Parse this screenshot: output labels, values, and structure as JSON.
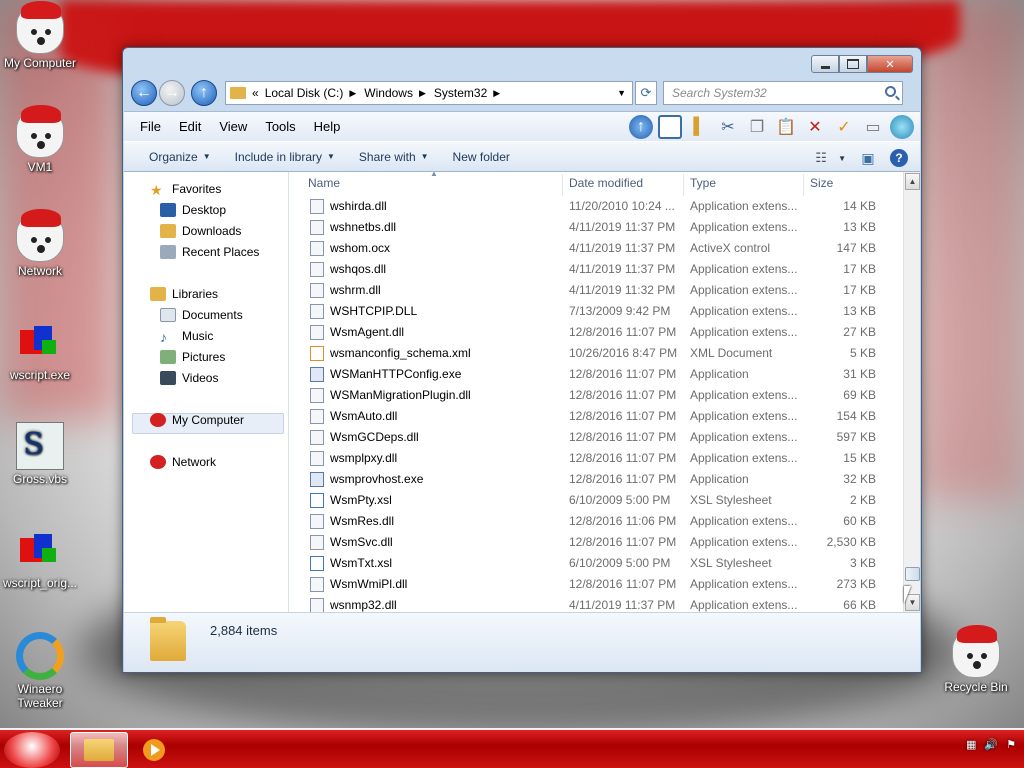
{
  "desktop": {
    "icons": [
      {
        "label": "My Computer",
        "kind": "dog-icon"
      },
      {
        "label": "VM1",
        "kind": "dog-icon"
      },
      {
        "label": "Network",
        "kind": "dog-icon"
      },
      {
        "label": "wscript.exe",
        "kind": "cube-icon"
      },
      {
        "label": "Gross.vbs",
        "kind": "script-icon"
      },
      {
        "label": "wscript_orig...",
        "kind": "cube-icon"
      },
      {
        "label": "Winaero Tweaker",
        "kind": "winaero-icon"
      },
      {
        "label": "Recycle Bin",
        "kind": "dog-icon"
      }
    ]
  },
  "window": {
    "address": {
      "prefix": "«",
      "segments": [
        "Local Disk (C:)",
        "Windows",
        "System32"
      ]
    },
    "search": {
      "placeholder": "Search System32"
    },
    "menu": [
      "File",
      "Edit",
      "View",
      "Tools",
      "Help"
    ],
    "commands": {
      "organize": "Organize",
      "include": "Include in library",
      "share": "Share with",
      "new_folder": "New folder"
    },
    "nav": {
      "favorites": "Favorites",
      "desktop": "Desktop",
      "downloads": "Downloads",
      "recent": "Recent Places",
      "libraries": "Libraries",
      "documents": "Documents",
      "music": "Music",
      "pictures": "Pictures",
      "videos": "Videos",
      "computer": "My Computer",
      "network": "Network"
    },
    "columns": {
      "name": "Name",
      "date": "Date modified",
      "type": "Type",
      "size": "Size"
    },
    "files": [
      {
        "name": "wshirda.dll",
        "date": "11/20/2010 10:24 ...",
        "type": "Application extens...",
        "size": "14 KB"
      },
      {
        "name": "wshnetbs.dll",
        "date": "4/11/2019 11:37 PM",
        "type": "Application extens...",
        "size": "13 KB"
      },
      {
        "name": "wshom.ocx",
        "date": "4/11/2019 11:37 PM",
        "type": "ActiveX control",
        "size": "147 KB"
      },
      {
        "name": "wshqos.dll",
        "date": "4/11/2019 11:37 PM",
        "type": "Application extens...",
        "size": "17 KB"
      },
      {
        "name": "wshrm.dll",
        "date": "4/11/2019 11:32 PM",
        "type": "Application extens...",
        "size": "17 KB"
      },
      {
        "name": "WSHTCPIP.DLL",
        "date": "7/13/2009 9:42 PM",
        "type": "Application extens...",
        "size": "13 KB"
      },
      {
        "name": "WsmAgent.dll",
        "date": "12/8/2016 11:07 PM",
        "type": "Application extens...",
        "size": "27 KB"
      },
      {
        "name": "wsmanconfig_schema.xml",
        "date": "10/26/2016 8:47 PM",
        "type": "XML Document",
        "size": "5 KB"
      },
      {
        "name": "WSManHTTPConfig.exe",
        "date": "12/8/2016 11:07 PM",
        "type": "Application",
        "size": "31 KB"
      },
      {
        "name": "WSManMigrationPlugin.dll",
        "date": "12/8/2016 11:07 PM",
        "type": "Application extens...",
        "size": "69 KB"
      },
      {
        "name": "WsmAuto.dll",
        "date": "12/8/2016 11:07 PM",
        "type": "Application extens...",
        "size": "154 KB"
      },
      {
        "name": "WsmGCDeps.dll",
        "date": "12/8/2016 11:07 PM",
        "type": "Application extens...",
        "size": "597 KB"
      },
      {
        "name": "wsmplpxy.dll",
        "date": "12/8/2016 11:07 PM",
        "type": "Application extens...",
        "size": "15 KB"
      },
      {
        "name": "wsmprovhost.exe",
        "date": "12/8/2016 11:07 PM",
        "type": "Application",
        "size": "32 KB"
      },
      {
        "name": "WsmPty.xsl",
        "date": "6/10/2009 5:00 PM",
        "type": "XSL Stylesheet",
        "size": "2 KB"
      },
      {
        "name": "WsmRes.dll",
        "date": "12/8/2016 11:06 PM",
        "type": "Application extens...",
        "size": "60 KB"
      },
      {
        "name": "WsmSvc.dll",
        "date": "12/8/2016 11:07 PM",
        "type": "Application extens...",
        "size": "2,530 KB"
      },
      {
        "name": "WsmTxt.xsl",
        "date": "6/10/2009 5:00 PM",
        "type": "XSL Stylesheet",
        "size": "3 KB"
      },
      {
        "name": "WsmWmiPl.dll",
        "date": "12/8/2016 11:07 PM",
        "type": "Application extens...",
        "size": "273 KB"
      },
      {
        "name": "wsnmp32.dll",
        "date": "4/11/2019 11:37 PM",
        "type": "Application extens...",
        "size": "66 KB"
      }
    ],
    "status": {
      "items": "2,884 items"
    }
  },
  "taskbar": {
    "apps": [
      "explorer-icon",
      "media-player-icon"
    ]
  }
}
